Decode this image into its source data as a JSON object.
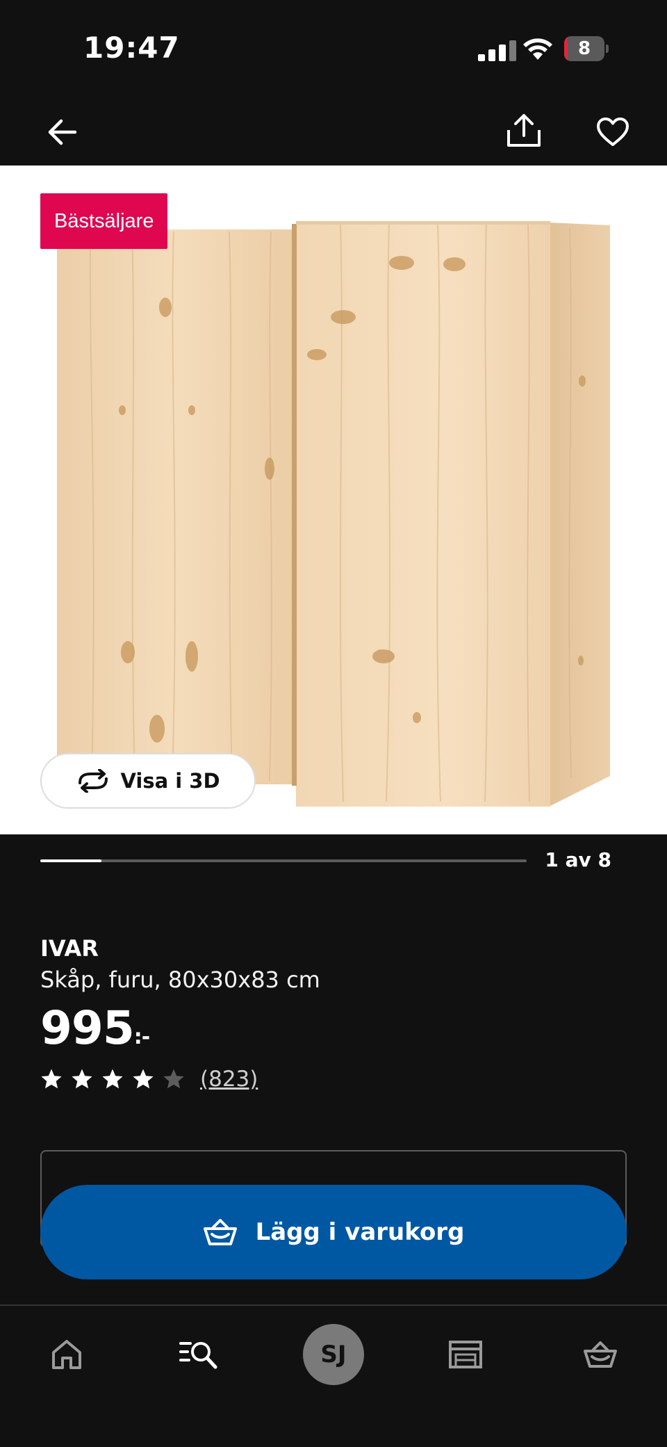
{
  "status_bar": {
    "time": "19:47",
    "battery_level": "8",
    "battery_fraction": 0.08,
    "battery_color": "#e5243b"
  },
  "top_nav": {
    "back_icon": "arrow-left-icon",
    "share_icon": "share-icon",
    "favorite_icon": "heart-icon"
  },
  "gallery": {
    "badge": "Bästsäljare",
    "badge_color": "#e00751",
    "view_3d_label": "Visa i 3D",
    "view_3d_icon": "rotate-icon",
    "page_indicator": "1 av 8",
    "progress_fraction": 0.125
  },
  "product": {
    "name": "IVAR",
    "description": "Skåp, furu, 80x30x83 cm",
    "price": "995",
    "price_suffix": ":-",
    "rating": 4,
    "rating_max": 5,
    "review_count": "(823)"
  },
  "actions": {
    "add_to_cart_label": "Lägg i varukorg",
    "add_to_cart_icon": "basket-icon",
    "accent_color": "#0058a3"
  },
  "tab_bar": {
    "items": [
      {
        "name": "home",
        "icon": "home-icon"
      },
      {
        "name": "search",
        "icon": "search-list-icon"
      },
      {
        "name": "profile",
        "icon": "avatar",
        "initials": "SJ"
      },
      {
        "name": "stores",
        "icon": "store-icon"
      },
      {
        "name": "cart",
        "icon": "basket-icon"
      }
    ]
  }
}
